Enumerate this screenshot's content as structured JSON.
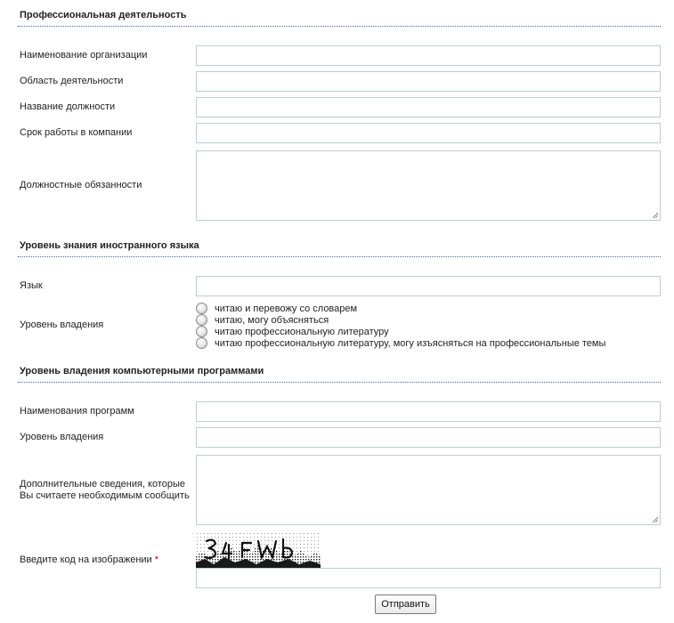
{
  "sections": {
    "professional": {
      "title": "Профессиональная деятельность",
      "fields": {
        "organization": "Наименование организации",
        "field_of_activity": "Область деятельности",
        "position": "Название должности",
        "tenure": "Срок работы в компании",
        "duties": "Должностные обязанности"
      }
    },
    "language": {
      "title": "Уровень знания иностранного языка",
      "language_label": "Язык",
      "level_label": "Уровень владения",
      "levels": [
        "читаю и перевожу со словарем",
        "читаю, могу объясняться",
        "читаю профессиональную литературу",
        "читаю профессиональную литературу, могу изъясняться на профессиональные темы"
      ]
    },
    "software": {
      "title": "Уровень владения компьютерными программами",
      "programs_label": "Наименования программ",
      "level_label": "Уровень владения",
      "additional_label_line1": "Дополнительные сведения, которые",
      "additional_label_line2": "Вы считаете необходимым сообщить"
    }
  },
  "captcha": {
    "label": "Введите код на изображении",
    "required_mark": "*"
  },
  "submit_label": "Отправить"
}
